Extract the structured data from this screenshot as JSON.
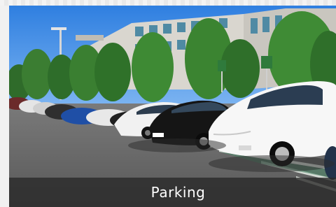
{
  "caption": {
    "label": "Parking"
  }
}
